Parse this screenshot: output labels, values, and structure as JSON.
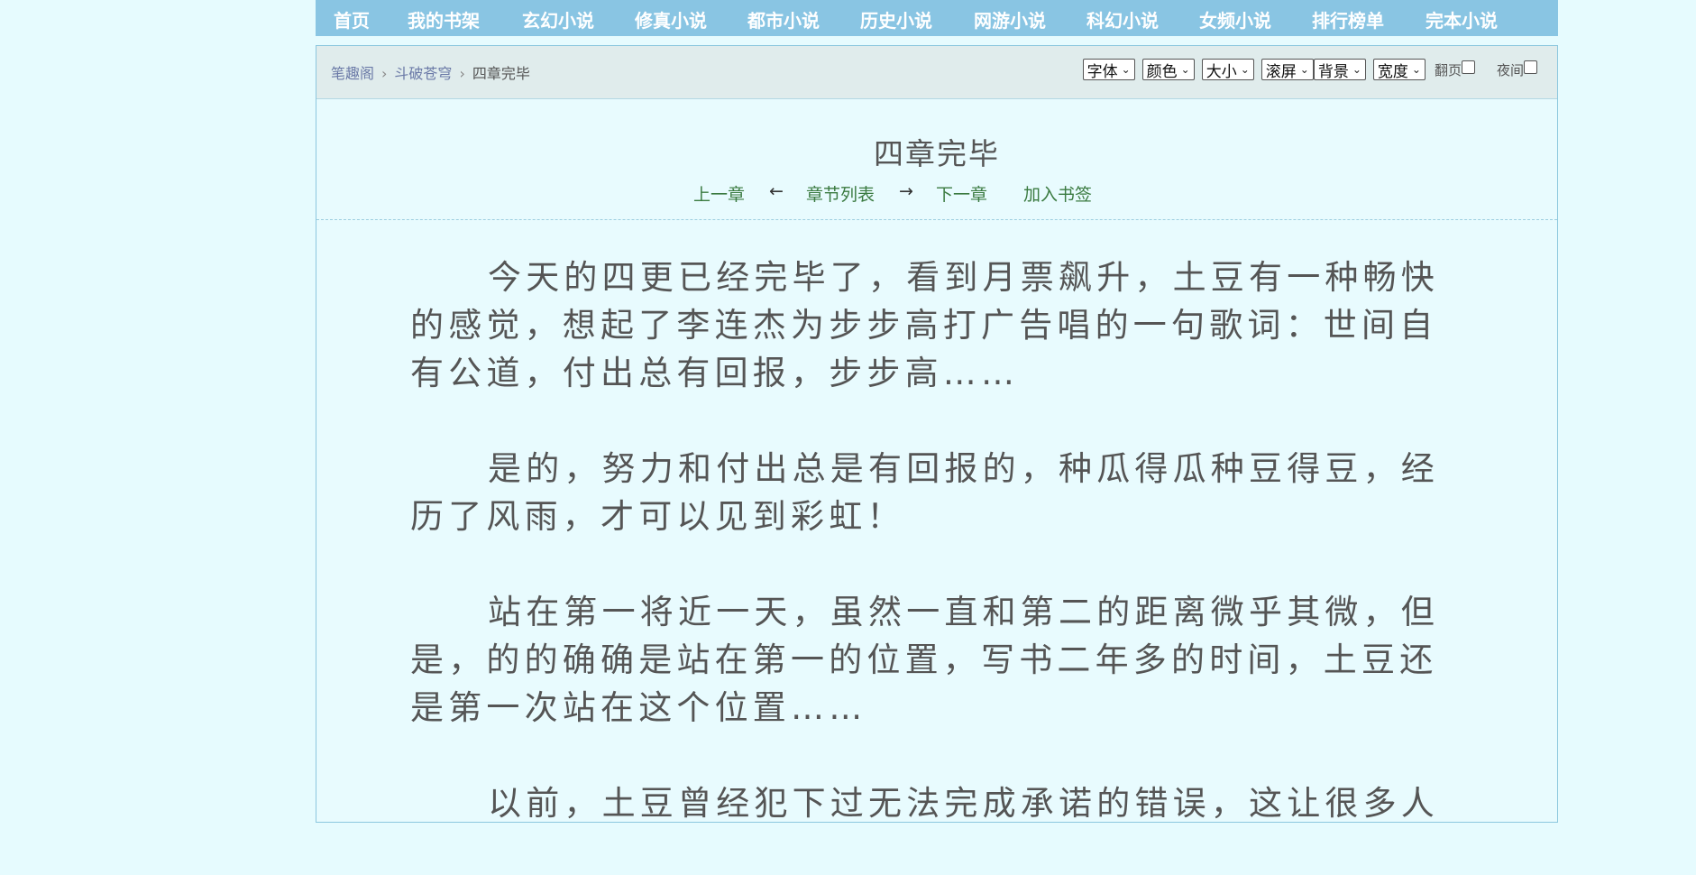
{
  "topnav": {
    "items": [
      "首页",
      "我的书架",
      "玄幻小说",
      "修真小说",
      "都市小说",
      "历史小说",
      "网游小说",
      "科幻小说",
      "女频小说",
      "排行榜单",
      "完本小说"
    ]
  },
  "breadcrumb": {
    "site": "笔趣阁",
    "book": "斗破苍穹",
    "chapter": "四章完毕",
    "separator": "›"
  },
  "toolbar": {
    "font": "字体",
    "color": "颜色",
    "size": "大小",
    "scroll": "滚屏",
    "background": "背景",
    "width": "宽度",
    "page_flip": "翻页",
    "night": "夜间"
  },
  "chapter": {
    "title": "四章完毕",
    "prev": "上一章",
    "arrow_left": "←",
    "list": "章节列表",
    "arrow_right": "→",
    "next": "下一章",
    "bookmark": "加入书签"
  },
  "content": {
    "paragraphs": [
      "今天的四更已经完毕了，看到月票飙升，土豆有一种畅快的感觉，想起了李连杰为步步高打广告唱的一句歌词：世间自有公道，付出总有回报，步步高……",
      "是的，努力和付出总是有回报的，种瓜得瓜种豆得豆，经历了风雨，才可以见到彩虹！",
      "站在第一将近一天，虽然一直和第二的距离微乎其微，但是，的的确确是站在第一的位置，写书二年多的时间，土豆还是第一次站在这个位置……",
      "以前，土豆曾经犯下过无法完成承诺的错误，这让很多人"
    ]
  }
}
